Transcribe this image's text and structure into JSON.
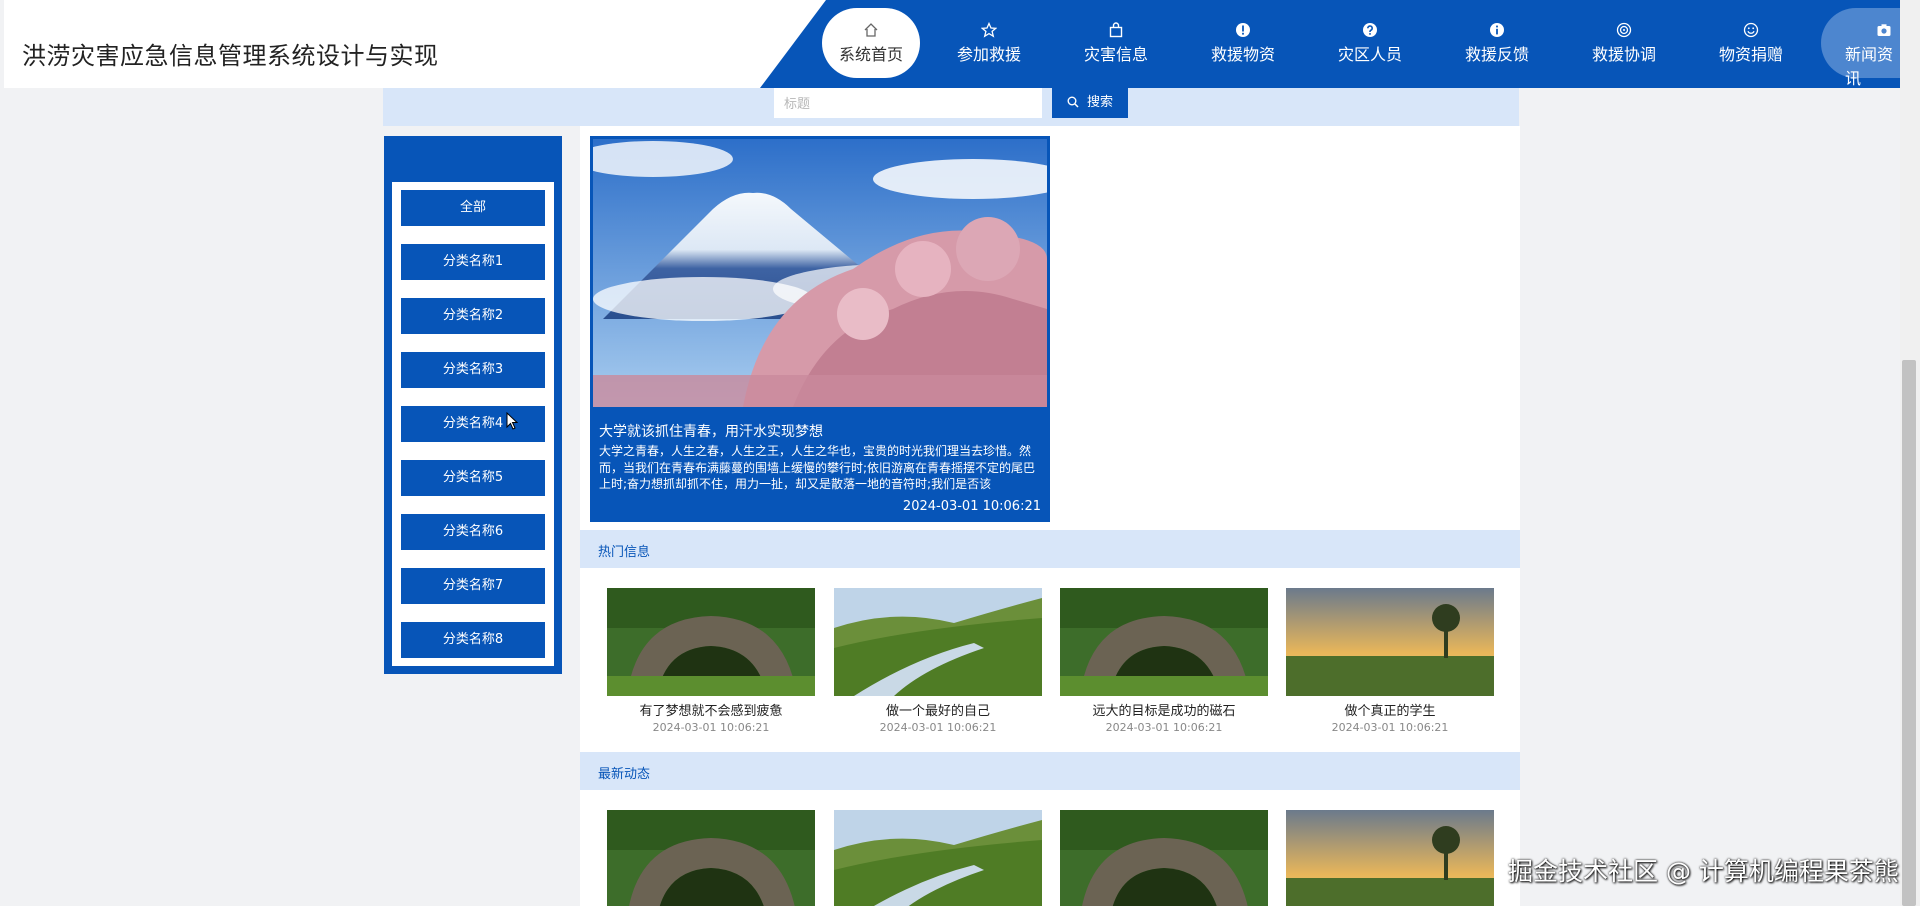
{
  "site": {
    "title": "洪涝灾害应急信息管理系统设计与实现"
  },
  "nav": {
    "items": [
      {
        "label": "系统首页",
        "icon": "home-icon",
        "active": true
      },
      {
        "label": "参加救援",
        "icon": "star-icon"
      },
      {
        "label": "灾害信息",
        "icon": "bag-icon"
      },
      {
        "label": "救援物资",
        "icon": "alert-icon"
      },
      {
        "label": "灾区人员",
        "icon": "question-icon"
      },
      {
        "label": "救援反馈",
        "icon": "info-icon"
      },
      {
        "label": "救援协调",
        "icon": "target-icon"
      },
      {
        "label": "物资捐赠",
        "icon": "smile-icon"
      },
      {
        "label": "新闻资讯",
        "icon": "camera-icon"
      }
    ]
  },
  "search": {
    "placeholder": "标题",
    "button_label": "搜索"
  },
  "sidebar": {
    "categories": [
      "全部",
      "分类名称1",
      "分类名称2",
      "分类名称3",
      "分类名称4",
      "分类名称5",
      "分类名称6",
      "分类名称7",
      "分类名称8"
    ]
  },
  "featured": {
    "title": "大学就该抓住青春，用汗水实现梦想",
    "description": "大学之青春，人生之春，人生之王，人生之华也，宝贵的时光我们理当去珍惜。然而，当我们在青春布满藤蔓的围墙上缓慢的攀行时;依旧游离在青春摇摆不定的尾巴上时;奋力想抓却抓不住，用力一扯，却又是散落一地的音符时;我们是否该",
    "date": "2024-03-01 10:06:21"
  },
  "hot": {
    "heading": "热门信息",
    "items": [
      {
        "title": "有了梦想就不会感到疲惫",
        "date": "2024-03-01 10:06:21",
        "image": "stone-bridge"
      },
      {
        "title": "做一个最好的自己",
        "date": "2024-03-01 10:06:21",
        "image": "valley-stream"
      },
      {
        "title": "远大的目标是成功的磁石",
        "date": "2024-03-01 10:06:21",
        "image": "stone-bridge"
      },
      {
        "title": "做个真正的学生",
        "date": "2024-03-01 10:06:21",
        "image": "sunset-field"
      }
    ]
  },
  "latest": {
    "heading": "最新动态",
    "items": [
      {
        "image": "stone-bridge"
      },
      {
        "image": "valley-stream"
      },
      {
        "image": "stone-bridge"
      },
      {
        "image": "sunset-field"
      }
    ]
  },
  "watermark": "掘金技术社区 @ 计算机编程果茶熊",
  "colors": {
    "primary": "#0755b8",
    "section_bg": "#d8e6f9",
    "page_bg": "#f1f2f4"
  }
}
